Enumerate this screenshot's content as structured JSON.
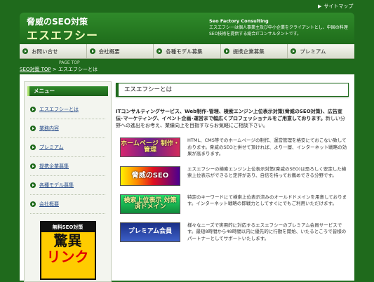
{
  "header": {
    "sitemap_link": "サイトマップ",
    "logo_line1": "脅威のSEO対策",
    "logo_line2": "エスエフシー",
    "desc_title": "Seo Factory Consulting",
    "desc_text": "エスエフシーは個人事業主及び中小企業をクライアントとし、中国の料理SEO技術を提供する総合ITコンサルタントです。"
  },
  "nav": {
    "items": [
      "お問い合せ",
      "会社概要",
      "各種モデル募集",
      "提携企業募集",
      "プレミアム"
    ]
  },
  "breadcrumb": {
    "pagetop": "PAGE TOP",
    "home": "SEO対策 TOP",
    "separator": ">",
    "current": "エスエフシーとは"
  },
  "sidebar": {
    "menu_title": "メニュー",
    "items": [
      "エスエフシーとは",
      "業務内容",
      "プレミアム",
      "提携企業募集",
      "各種モデル募集",
      "会社概要"
    ],
    "banner": {
      "line1": "無料SEO対策",
      "line2": "驚異",
      "line3": "リンク"
    }
  },
  "main": {
    "title": "エスエフシーとは",
    "intro_bold": "ITコンサルティングサービス、Web制作･管理、検索エンジン上位表示対策(脅威のSEO対策)、広告宣伝･マーケティング、イベント企画･運営まで幅広くプロフェッショナルをご用意しております。",
    "intro_rest": "新しい分野への進出をお考え、業績向上を目指すならお気軽にご相談下さい。",
    "services": [
      {
        "image_text": "ホームページ 制作・管理",
        "text": "HTML、CMS等でのホームページの制作、運営管理を格安にておこない致しております。脅威のSEOと併せて頂ければ、より一層、インターネット戦略の効果が高まります。"
      },
      {
        "image_text": "脅威のSEO",
        "text": "エスエフシーの検索エンジン上位表示対策(脅威のSEO)は恐ろしく安定した検索上位表示ができると定評があり、自信を持ってお薦めできる分野です。"
      },
      {
        "image_text": "検索上位表示 対策済ドメイン",
        "text": "特定のキーワードにて検索上位表示済みのオールドドメインを用意しております。インターネット戦略の即戦力としてすぐにでもご利用いただけます。"
      },
      {
        "image_text": "プレミアム会員",
        "text": "様々なニーズで実用的に対応するエスエフシーのプレミアム会員サービスです。最短8時間から48時間以内に優先的に行動を開始、いたるところで皆様のパートナーとしてサポートいたします。"
      }
    ]
  }
}
